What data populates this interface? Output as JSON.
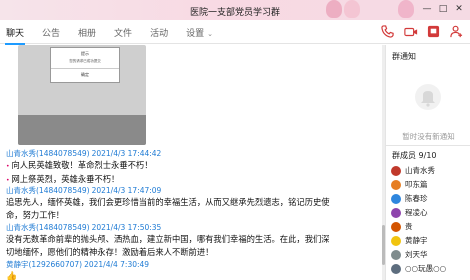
{
  "window": {
    "title": "医院一支部党员学习群",
    "buttons": [
      "—",
      "□",
      "✕"
    ]
  },
  "tabs": [
    {
      "label": "聊天",
      "active": true
    },
    {
      "label": "公告",
      "active": false
    },
    {
      "label": "相册",
      "active": false
    },
    {
      "label": "文件",
      "active": false
    },
    {
      "label": "活动",
      "active": false
    },
    {
      "label": "设置",
      "active": false,
      "dropdown": true
    }
  ],
  "tools": [
    "phone-icon",
    "video-icon",
    "screen-share-icon",
    "add-member-icon"
  ],
  "screenshot": {
    "line1": "提示",
    "line2": "您的请求已成功提交",
    "line3": "确定"
  },
  "messages": [
    {
      "sender": "山青水秀(1484078549)",
      "time": "2021/4/3 17:44:42",
      "lines": [
        "向人民英雄致敬！革命烈士永垂不朽！",
        "网上祭英烈，英雄永垂不朽！"
      ],
      "bullets": true
    },
    {
      "sender": "山青水秀(1484078549)",
      "time": "2021/4/3 17:47:09",
      "lines": [
        "追思先人，缅怀英雄，我们会更珍惜当前的幸福生活，从而又继承先烈遗志，铭记历史使",
        "命，努力工作！"
      ],
      "bullets": false
    },
    {
      "sender": "山青水秀(1484078549)",
      "time": "2021/4/3 17:50:35",
      "lines": [
        "没有无数革命前辈的抛头颅、洒热血，建立新中国，哪有我们幸福的生活。在此，我们深",
        "切地缅怀，愿他们的精神永存！激励着后来人不断前进！"
      ],
      "bullets": false
    },
    {
      "sender": "黄静宇(1292660707)",
      "time": "2021/4/4 7:30:49",
      "lines": [
        ""
      ],
      "bullets": false
    }
  ],
  "right_panel": {
    "notice_title": "群通知",
    "notice_empty": "暂时没有新通知",
    "members_title": "群成员 9/10",
    "members": [
      {
        "name": "山青水秀",
        "color": "#c0392b"
      },
      {
        "name": "叩东篇",
        "color": "#e67e22"
      },
      {
        "name": "陈春珍",
        "color": "#2e86de"
      },
      {
        "name": "程凌心",
        "color": "#8e44ad"
      },
      {
        "name": "贵",
        "color": "#d35400"
      },
      {
        "name": "黄静宇",
        "color": "#f1c40f"
      },
      {
        "name": "刘天华",
        "color": "#7f8c8d"
      },
      {
        "name": "○○玩愚○○",
        "color": "#5d6d7e"
      }
    ]
  },
  "colors": {
    "accent": "#1e9bff",
    "sender": "#1f7bd4",
    "titlebar": "#f7dde6"
  }
}
